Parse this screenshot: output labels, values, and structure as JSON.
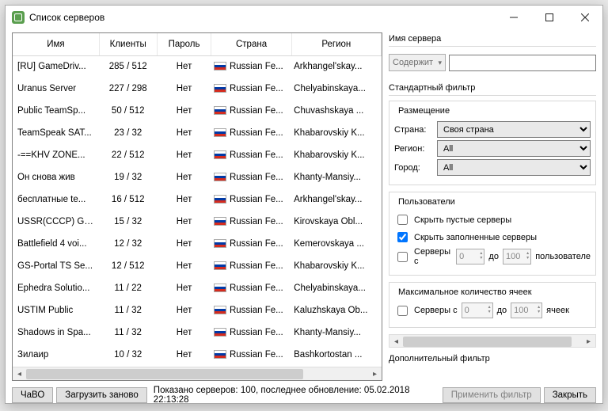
{
  "window": {
    "title": "Список серверов"
  },
  "columns": [
    "Имя",
    "Клиенты",
    "Пароль",
    "Страна",
    "Регион"
  ],
  "rows": [
    {
      "name": "[RU] GameDriv...",
      "clients": "285 / 512",
      "pass": "Нет",
      "country": "Russian Fe...",
      "region": "Arkhangel'skay..."
    },
    {
      "name": "Uranus Server",
      "clients": "227 / 298",
      "pass": "Нет",
      "country": "Russian Fe...",
      "region": "Chelyabinskaya..."
    },
    {
      "name": "Public TeamSp...",
      "clients": "50 / 512",
      "pass": "Нет",
      "country": "Russian Fe...",
      "region": "Chuvashskaya ..."
    },
    {
      "name": "TeamSpeak SAT...",
      "clients": "23 / 32",
      "pass": "Нет",
      "country": "Russian Fe...",
      "region": "Khabarovskiy K..."
    },
    {
      "name": "-==KHV ZONE...",
      "clients": "22 / 512",
      "pass": "Нет",
      "country": "Russian Fe...",
      "region": "Khabarovskiy K..."
    },
    {
      "name": "Он снова жив",
      "clients": "19 / 32",
      "pass": "Нет",
      "country": "Russian Fe...",
      "region": "Khanty-Mansiy..."
    },
    {
      "name": "бесплатные te...",
      "clients": "16 / 512",
      "pass": "Нет",
      "country": "Russian Fe...",
      "region": "Arkhangel'skay..."
    },
    {
      "name": "USSR(CCCP) Ga...",
      "clients": "15 / 32",
      "pass": "Нет",
      "country": "Russian Fe...",
      "region": "Kirovskaya Obl..."
    },
    {
      "name": "Battlefield 4 voi...",
      "clients": "12 / 32",
      "pass": "Нет",
      "country": "Russian Fe...",
      "region": "Kemerovskaya ..."
    },
    {
      "name": "GS-Portal TS Se...",
      "clients": "12 / 512",
      "pass": "Нет",
      "country": "Russian Fe...",
      "region": "Khabarovskiy K..."
    },
    {
      "name": "Ephedra Solutio...",
      "clients": "11 / 22",
      "pass": "Нет",
      "country": "Russian Fe...",
      "region": "Chelyabinskaya..."
    },
    {
      "name": "USTIM Public",
      "clients": "11 / 32",
      "pass": "Нет",
      "country": "Russian Fe...",
      "region": "Kaluzhskaya Ob..."
    },
    {
      "name": "Shadows in Spa...",
      "clients": "11 / 32",
      "pass": "Нет",
      "country": "Russian Fe...",
      "region": "Khanty-Mansiy..."
    },
    {
      "name": "Зилаир",
      "clients": "10 / 32",
      "pass": "Нет",
      "country": "Russian Fe...",
      "region": "Bashkortostan ..."
    }
  ],
  "filter": {
    "serverNameLabel": "Имя сервера",
    "matchMode": "Содержит",
    "standardLabel": "Стандартный фильтр",
    "placementLabel": "Размещение",
    "countryLabel": "Страна:",
    "countryValue": "Своя страна",
    "regionLabel": "Регион:",
    "regionValue": "All",
    "cityLabel": "Город:",
    "cityValue": "All",
    "usersLabel": "Пользователи",
    "hideEmpty": "Скрыть пустые серверы",
    "hideFull": "Скрыть заполненные серверы",
    "serversWith": "Серверы с",
    "to": "до",
    "usersUnit": "пользователе",
    "maxSlotsLabel": "Максимальное количество ячеек",
    "slotsUnit": "ячеек",
    "spin0": "0",
    "spin100": "100",
    "additionalLabel": "Дополнительный фильтр"
  },
  "footer": {
    "faq": "ЧаВО",
    "reload": "Загрузить заново",
    "status": "Показано серверов: 100, последнее обновление: 05.02.2018 22:13:28",
    "apply": "Применить фильтр",
    "close": "Закрыть"
  }
}
